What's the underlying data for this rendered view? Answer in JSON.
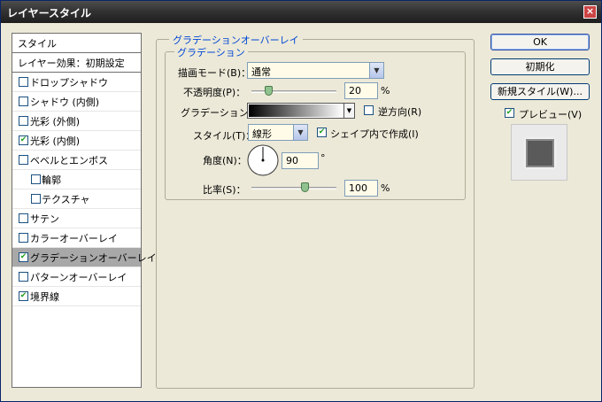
{
  "window": {
    "title": "レイヤースタイル",
    "close_glyph": "×"
  },
  "sidebar": {
    "header": "スタイル",
    "blending": "レイヤー効果：初期設定",
    "items": [
      {
        "label": "ドロップシャドウ",
        "checked": false,
        "indent": false,
        "selected": false
      },
      {
        "label": "シャドウ (内側)",
        "checked": false,
        "indent": false,
        "selected": false
      },
      {
        "label": "光彩 (外側)",
        "checked": false,
        "indent": false,
        "selected": false
      },
      {
        "label": "光彩 (内側)",
        "checked": true,
        "indent": false,
        "selected": false
      },
      {
        "label": "ベベルとエンボス",
        "checked": false,
        "indent": false,
        "selected": false
      },
      {
        "label": "輪郭",
        "checked": false,
        "indent": true,
        "selected": false
      },
      {
        "label": "テクスチャ",
        "checked": false,
        "indent": true,
        "selected": false
      },
      {
        "label": "サテン",
        "checked": false,
        "indent": false,
        "selected": false
      },
      {
        "label": "カラーオーバーレイ",
        "checked": false,
        "indent": false,
        "selected": false
      },
      {
        "label": "グラデーションオーバーレイ",
        "checked": true,
        "indent": false,
        "selected": true
      },
      {
        "label": "パターンオーバーレイ",
        "checked": false,
        "indent": false,
        "selected": false
      },
      {
        "label": "境界線",
        "checked": true,
        "indent": false,
        "selected": false
      }
    ]
  },
  "panel": {
    "group_title": "グラデーションオーバーレイ",
    "sub_group_title": "グラデーション",
    "blend_mode_label": "描画モード(B)：",
    "blend_mode_value": "通常",
    "opacity_label": "不透明度(P)：",
    "opacity_value": "20",
    "opacity_unit": "%",
    "opacity_fraction": 0.2,
    "gradient_label": "グラデーション：",
    "reverse_label": "逆方向(R)",
    "reverse_checked": false,
    "style_label": "スタイル(T)：",
    "style_value": "線形",
    "align_label": "シェイプ内で作成(I)",
    "align_checked": true,
    "angle_label": "角度(N)：",
    "angle_value": "90",
    "angle_unit": "°",
    "scale_label": "比率(S)：",
    "scale_value": "100",
    "scale_unit": "%",
    "scale_fraction": 0.5
  },
  "buttons": {
    "ok": "OK",
    "reset": "初期化",
    "new_style": "新規スタイル(W)...",
    "preview_label": "プレビュー(V)",
    "preview_checked": true
  }
}
